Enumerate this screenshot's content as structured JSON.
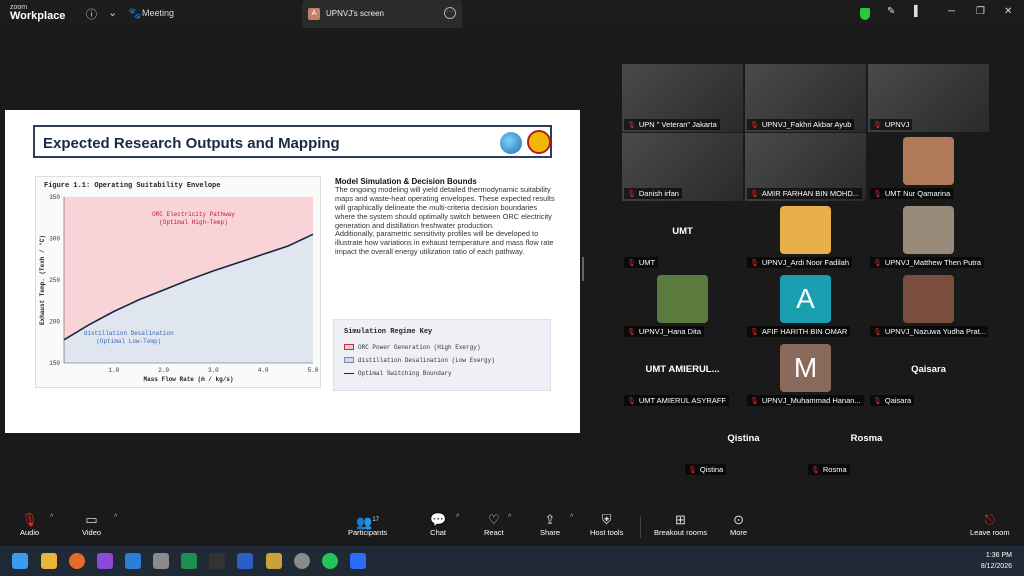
{
  "app": {
    "brand_line1": "zoom",
    "brand_line2": "Workplace",
    "meeting_label": "Meeting",
    "tab_avatar": "A",
    "tab_label": "UPNVJ's screen"
  },
  "slide": {
    "title": "Expected Research Outputs and Mapping",
    "desc_heading": "Model Simulation & Decision Bounds",
    "desc_p1": "The ongoing modeling will yield detailed thermodynamic suitability maps and waste-heat operating envelopes. These expected results will graphically delineate the multi-criteria decision boundaries where the system should optimally switch between ORC electricity generation and distillation freshwater production.",
    "desc_p2": "Additionally, parametric sensitivity profiles will be developed to illustrate how variations in exhaust temperature and mass flow rate impact the overall energy utilization ratio of each pathway.",
    "key_title": "Simulation Regime Key",
    "key_items": [
      "ORC Power Generation (High Exergy)",
      "distillation Desalination (Low Exergy)",
      "Optimal Switching Boundary"
    ]
  },
  "chart_data": {
    "type": "area",
    "title": "Figure 1.1: Operating Suitability Envelope",
    "xlabel": "Mass Flow Rate (ṁ / kg/s)",
    "ylabel": "Exhaust Temp. (Texh / °C)",
    "xlim": [
      0.0,
      5.0
    ],
    "ylim": [
      150,
      350
    ],
    "x_ticks": [
      "1.0",
      "2.0",
      "3.0",
      "4.0",
      "5.0"
    ],
    "y_ticks": [
      "150",
      "200",
      "250",
      "300",
      "350"
    ],
    "boundary": {
      "name": "Optimal Switching Boundary",
      "x": [
        0.0,
        0.5,
        1.0,
        1.5,
        2.0,
        2.5,
        3.0,
        3.5,
        4.0,
        4.5,
        5.0
      ],
      "y": [
        178,
        196,
        212,
        226,
        238,
        250,
        261,
        271,
        281,
        291,
        305
      ]
    },
    "regions": [
      {
        "label_line1": "ORC Electricity Pathway",
        "label_line2": "(Optimal High-Temp)",
        "color": "#f8d4d8"
      },
      {
        "label_line1": "distillation Desalination",
        "label_line2": "(Optimal Low-Temp)",
        "color": "#dfe6f0"
      }
    ],
    "grid": false
  },
  "participants": [
    {
      "name": "UPN \" Veteran\" Jakarta",
      "kind": "video"
    },
    {
      "name": "UPNVJ_Fakhri Akbar Ayub",
      "kind": "video"
    },
    {
      "name": "UPNVJ",
      "kind": "video",
      "active": true
    },
    {
      "name": "Danish irfan",
      "kind": "video"
    },
    {
      "name": "AMIR FARHAN BIN MOHD...",
      "kind": "video"
    },
    {
      "name": "UMT Nur Qamarina",
      "kind": "photo"
    },
    {
      "name": "UMT",
      "big": "UMT",
      "kind": "text"
    },
    {
      "name": "UPNVJ_Ardi Noor Fadilah",
      "kind": "photo"
    },
    {
      "name": "UPNVJ_Matthew Then Putra",
      "kind": "photo"
    },
    {
      "name": "UPNVJ_Hana Dita",
      "kind": "photo"
    },
    {
      "name": "AFIF HARITH BIN OMAR",
      "big": "A",
      "kind": "letter"
    },
    {
      "name": "UPNVJ_Nazuwa Yudha Prat...",
      "kind": "photo"
    },
    {
      "name": "UMT AMIERUL ASYRAFF",
      "big": "UMT  AMIERUL...",
      "kind": "text"
    },
    {
      "name": "UPNVJ_Muhammad Hanan...",
      "big": "M",
      "kind": "letter"
    },
    {
      "name": "Qaisara",
      "big": "Qaisara",
      "kind": "text"
    },
    {
      "name": "Qistina",
      "big": "Qistina",
      "kind": "text"
    },
    {
      "name": "Rosma",
      "big": "Rosma",
      "kind": "text"
    }
  ],
  "toolbar": {
    "audio": "Audio",
    "video": "Video",
    "participants": "Participants",
    "participants_count": "17",
    "chat": "Chat",
    "react": "React",
    "share": "Share",
    "host_tools": "Host tools",
    "breakout": "Breakout rooms",
    "more": "More",
    "leave": "Leave room"
  },
  "clock": {
    "time": "1:36 PM",
    "date": "8/12/2026"
  }
}
